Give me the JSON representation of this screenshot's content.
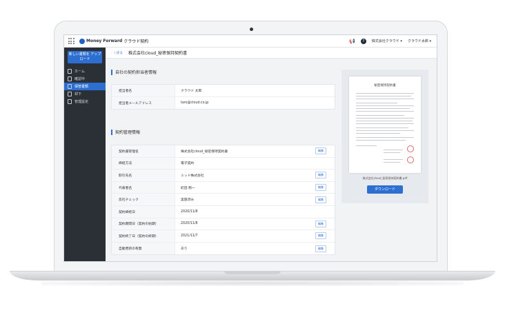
{
  "header": {
    "logo_text": "Money Forward",
    "product": "クラウド契約",
    "company": "株式会社クラウド ▾",
    "user": "クラウド太郎 ▾"
  },
  "sidebar": {
    "upload_label": "新しい書類を アップロード",
    "items": [
      {
        "label": "ホーム"
      },
      {
        "label": "確認中"
      },
      {
        "label": "保管書類"
      },
      {
        "label": "却下"
      },
      {
        "label": "管理設定"
      }
    ]
  },
  "page": {
    "back_label": "〈 戻る",
    "title": "株式会社cloud_秘密保持契約書"
  },
  "owner_section": {
    "title": "自社の契約担当者情報",
    "rows": [
      {
        "key": "担当者名",
        "value": "クラウド 太郎"
      },
      {
        "key": "担当者メールアドレス",
        "value": "taro@cloud.co.jp"
      }
    ]
  },
  "contract_section": {
    "title": "契約管理情報",
    "edit_label": "編集",
    "rows": [
      {
        "key": "契約書管理名",
        "value": "株式会社cloud_秘密保持契約書"
      },
      {
        "key": "締結方法",
        "value": "電子契約"
      },
      {
        "key": "取引先名",
        "value": "ミッド株式会社"
      },
      {
        "key": "代表者名",
        "value": "町田 剛一"
      },
      {
        "key": "反社チェック",
        "value": "実施済み"
      },
      {
        "key": "契約締結日",
        "value": "2020/11/8"
      },
      {
        "key": "契約期間日（契約の始期）",
        "value": "2020/11/8"
      },
      {
        "key": "契約終了日（契約の終期）",
        "value": "2021/11/7"
      },
      {
        "key": "自動更新の有無",
        "value": "あり"
      }
    ]
  },
  "preview": {
    "doc_title": "秘密保持契約書",
    "file_name": "株式会社cloud_秘密保持契約書.pdf",
    "download_label": "ダウンロード"
  }
}
